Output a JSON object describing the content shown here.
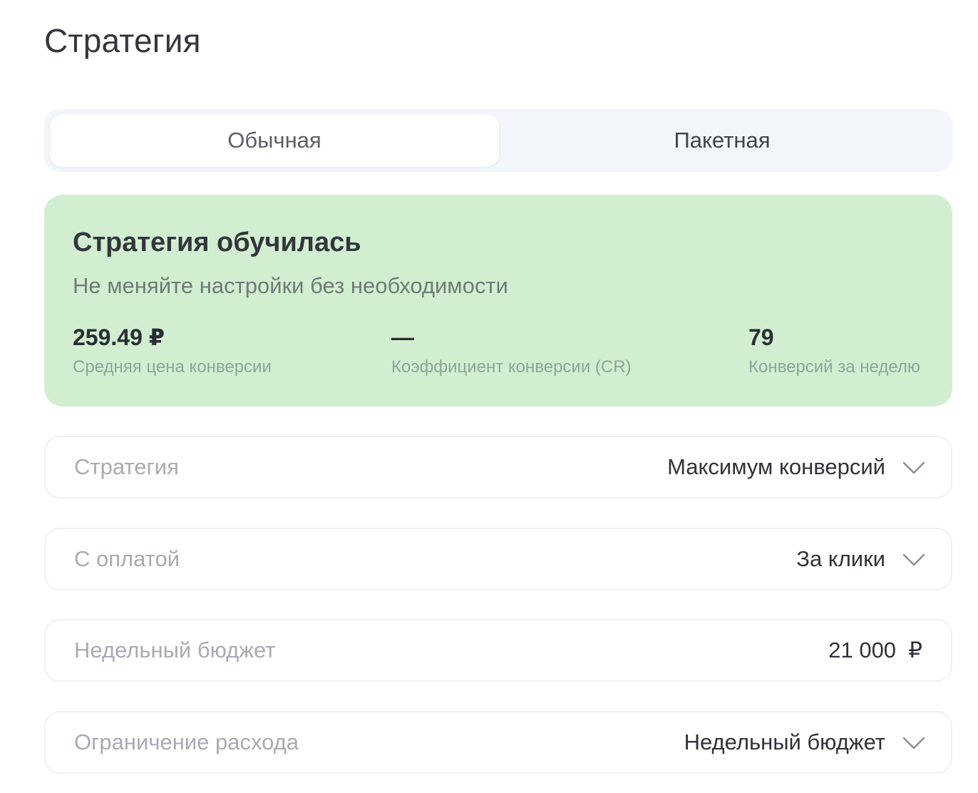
{
  "page": {
    "title": "Стратегия"
  },
  "tabs": [
    {
      "label": "Обычная",
      "active": true
    },
    {
      "label": "Пакетная",
      "active": false
    }
  ],
  "status": {
    "title": "Стратегия обучилась",
    "subtitle": "Не меняйте настройки без необходимости",
    "background_color": "#d1efd0",
    "metrics": [
      {
        "value": "259.49 ₽",
        "label": "Средняя цена конверсии"
      },
      {
        "value": "—",
        "label": "Коэффициент конверсии (CR)"
      },
      {
        "value": "79",
        "label": "Конверсий за неделю"
      }
    ]
  },
  "fields": [
    {
      "label": "Стратегия",
      "value": "Максимум конверсий",
      "icon": "chevron-down-icon"
    },
    {
      "label": "С оплатой",
      "value": "За клики",
      "icon": "chevron-down-icon"
    },
    {
      "label": "Недельный бюджет",
      "value": "21 000  ₽"
    },
    {
      "label": "Ограничение расхода",
      "value": "Недельный бюджет",
      "icon": "chevron-down-icon"
    }
  ]
}
